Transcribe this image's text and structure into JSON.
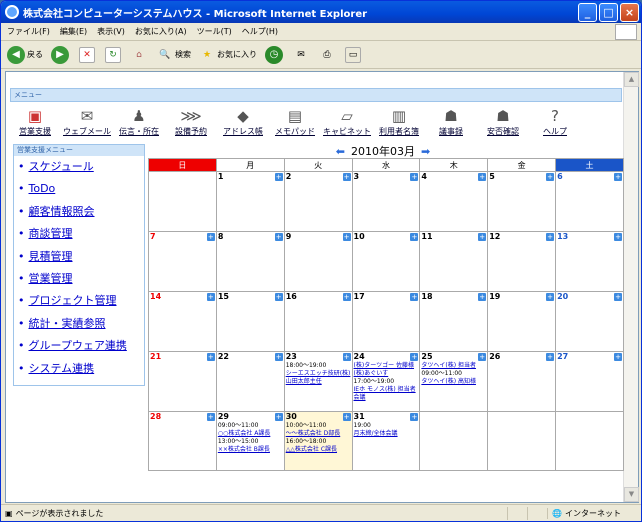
{
  "window": {
    "title": "株式会社コンピューターシステムハウス - Microsoft Internet Explorer"
  },
  "menubar": [
    "ファイル(F)",
    "編集(E)",
    "表示(V)",
    "お気に入り(A)",
    "ツール(T)",
    "ヘルプ(H)"
  ],
  "toolbar": {
    "back": "戻る",
    "search": "検索",
    "favorites": "お気に入り"
  },
  "menu": {
    "header": "メニュー",
    "items": [
      {
        "label": "営業支援",
        "icon": "sales-support-icon"
      },
      {
        "label": "ウェブメール",
        "icon": "mail-icon"
      },
      {
        "label": "伝言・所在",
        "icon": "person-icon"
      },
      {
        "label": "設備予約",
        "icon": "equipment-icon"
      },
      {
        "label": "アドレス帳",
        "icon": "address-book-icon"
      },
      {
        "label": "メモパッド",
        "icon": "memo-icon"
      },
      {
        "label": "キャビネット",
        "icon": "folder-icon"
      },
      {
        "label": "利用者名簿",
        "icon": "user-list-icon"
      },
      {
        "label": "議事録",
        "icon": "minutes-icon"
      },
      {
        "label": "安否確認",
        "icon": "safety-icon"
      },
      {
        "label": "ヘルプ",
        "icon": "help-icon"
      }
    ]
  },
  "sidebar": {
    "header": "営業支援メニュー",
    "items": [
      "スケジュール",
      "ToDo",
      "顧客情報照会",
      "商談管理",
      "見積管理",
      "営業管理",
      "プロジェクト管理",
      "統計・実績参照",
      "グループウェア連携",
      "システム連携"
    ]
  },
  "calendar": {
    "title": "2010年03月",
    "weekdays": [
      "日",
      "月",
      "火",
      "水",
      "木",
      "金",
      "土"
    ],
    "weeks": [
      [
        {
          "d": ""
        },
        {
          "d": "1"
        },
        {
          "d": "2"
        },
        {
          "d": "3"
        },
        {
          "d": "4"
        },
        {
          "d": "5"
        },
        {
          "d": "6"
        }
      ],
      [
        {
          "d": "7"
        },
        {
          "d": "8"
        },
        {
          "d": "9"
        },
        {
          "d": "10"
        },
        {
          "d": "11"
        },
        {
          "d": "12"
        },
        {
          "d": "13"
        }
      ],
      [
        {
          "d": "14"
        },
        {
          "d": "15"
        },
        {
          "d": "16"
        },
        {
          "d": "17"
        },
        {
          "d": "18"
        },
        {
          "d": "19"
        },
        {
          "d": "20"
        }
      ],
      [
        {
          "d": "21"
        },
        {
          "d": "22"
        },
        {
          "d": "23",
          "ev": [
            {
              "t": "18:00～19:00"
            },
            {
              "t": "シーエスエッチ技研(株)山田太郎主任",
              "l": 1
            }
          ]
        },
        {
          "d": "24",
          "ev": [
            {
              "t": "(株)ターツゴー 佐藤様",
              "l": 1
            },
            {
              "t": "(株)あぐいす",
              "l": 1
            },
            {
              "t": "17:00～19:00"
            },
            {
              "t": "IEホ モノス(株) 担当者会議",
              "l": 1
            }
          ]
        },
        {
          "d": "25",
          "ev": [
            {
              "t": "タツヘイ(株) 担当者",
              "l": 1
            },
            {
              "t": "09:00～11:00"
            },
            {
              "t": "タツヘイ(株) 高知様",
              "l": 1
            }
          ]
        },
        {
          "d": "26"
        },
        {
          "d": "27"
        }
      ],
      [
        {
          "d": "28"
        },
        {
          "d": "29",
          "ev": [
            {
              "t": "09:00～11:00"
            },
            {
              "t": "○○株式会社 A課長",
              "l": 1
            },
            {
              "t": "13:00～15:00"
            },
            {
              "t": "××株式会社 B課長",
              "l": 1
            }
          ]
        },
        {
          "d": "30",
          "today": 1,
          "ev": [
            {
              "t": "10:00～11:00"
            },
            {
              "t": "～～株式会社 D部長",
              "l": 1
            },
            {
              "t": "16:00～18:00"
            },
            {
              "t": "△△株式会社 C課長",
              "l": 1
            }
          ]
        },
        {
          "d": "31",
          "ev": [
            {
              "t": "19:00"
            },
            {
              "t": "月末締/全体会議",
              "l": 1
            }
          ]
        },
        {
          "d": ""
        },
        {
          "d": ""
        },
        {
          "d": ""
        }
      ]
    ]
  },
  "status": {
    "text": "ページが表示されました",
    "zone": "インターネット"
  }
}
